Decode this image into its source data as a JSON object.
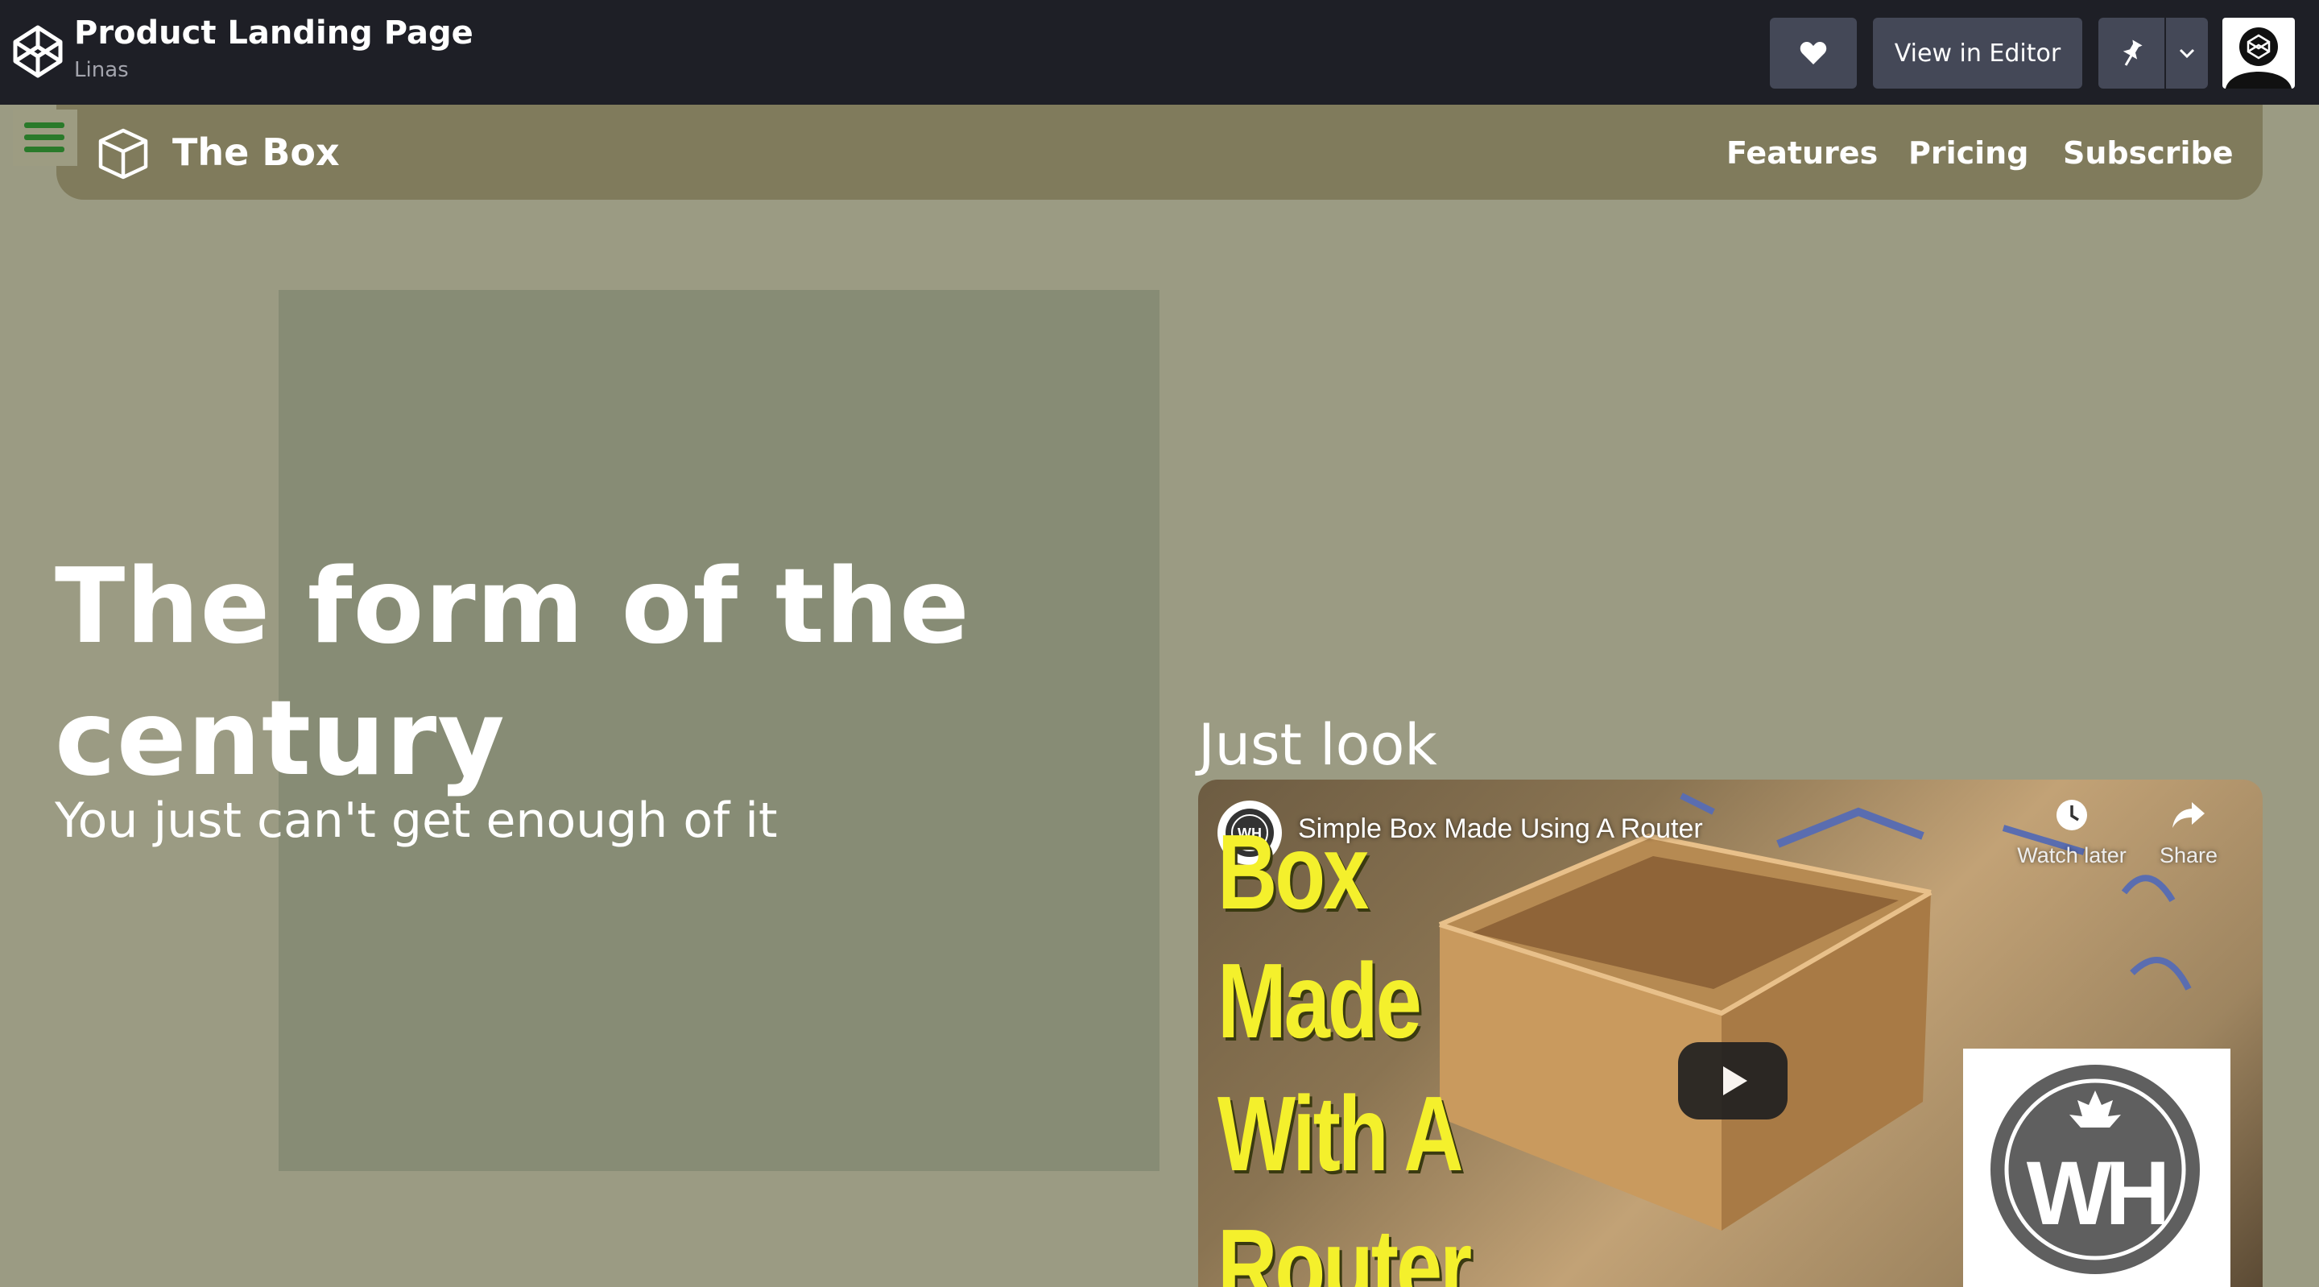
{
  "codepen": {
    "pen_title": "Product Landing Page",
    "author": "Linas",
    "view_in_editor": "View in Editor"
  },
  "nav": {
    "brand": "The Box",
    "links": [
      "Features",
      "Pricing",
      "Subscribe"
    ]
  },
  "hero": {
    "title": "The form of the century",
    "subtitle": "You just can't get enough of it"
  },
  "video_section": {
    "heading": "Just look",
    "video": {
      "title": "Simple Box Made Using A Router",
      "watch_later": "Watch later",
      "share": "Share",
      "thumbnail_lines": [
        "Box",
        "Made",
        "With A",
        "Router"
      ],
      "logo_text": "WH"
    }
  },
  "colors": {
    "page_bg": "#9b9b83",
    "nav_bg": "#807b5c",
    "hero_box": "#878c75",
    "topbar_bg": "#1e1f26",
    "hamburger": "#2a7a2a",
    "thumbnail_text": "#f4f02c"
  },
  "icons": [
    "codepen-logo-icon",
    "heart-icon",
    "pin-icon",
    "chevron-down-icon",
    "hamburger-icon",
    "cube-icon",
    "play-icon",
    "clock-icon",
    "share-icon"
  ]
}
